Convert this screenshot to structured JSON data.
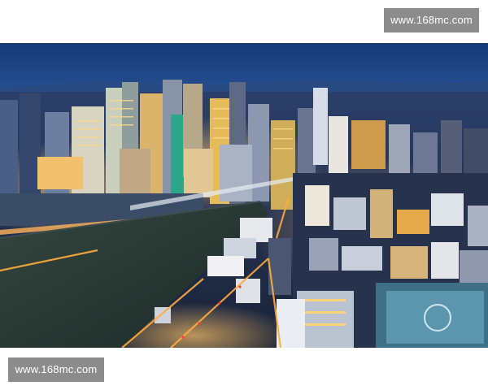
{
  "watermarks": {
    "top": "www.168mc.com",
    "bottom": "www.168mc.com"
  },
  "photo": {
    "subject": "Night aerial city skyline with illuminated skyscrapers and a dark open lot",
    "colors": {
      "sky_top": "#1a3e7a",
      "sky_horizon": "#2d5596",
      "lot": "#2a3a3a",
      "lights": "#ffb84d"
    }
  }
}
